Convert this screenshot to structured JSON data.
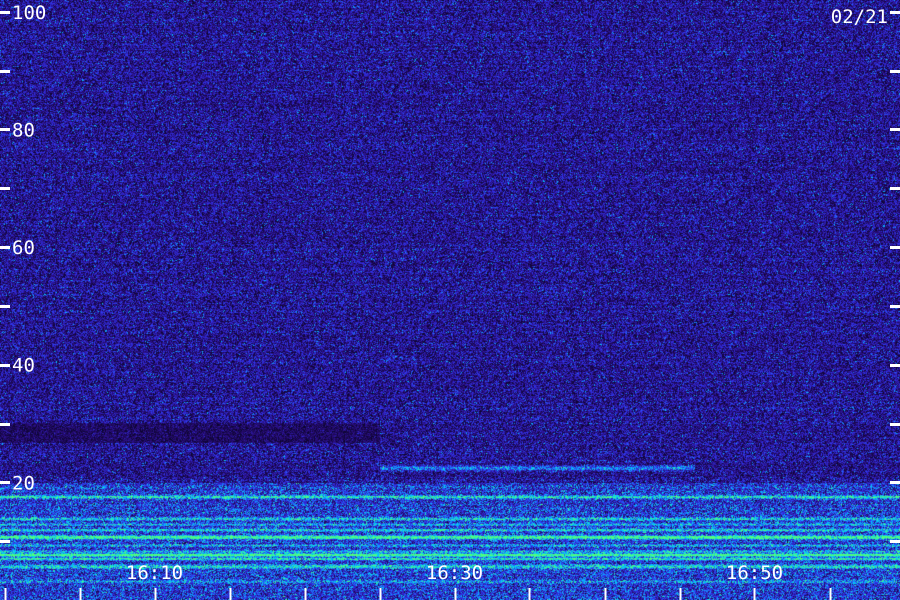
{
  "date_label": "02/21",
  "chart_data": {
    "type": "heatmap",
    "title": "",
    "xlabel": "",
    "ylabel": "",
    "x_tick_labels": [
      "16:10",
      "16:30",
      "16:50"
    ],
    "x_tick_minutes": [
      10,
      30,
      50
    ],
    "x_range_minutes": [
      -0.3,
      59.7
    ],
    "x_minor_every_minutes": 5,
    "y_tick_labels": [
      "20",
      "40",
      "60",
      "80",
      "100"
    ],
    "y_ticks": [
      20,
      40,
      60,
      80,
      100
    ],
    "y_minor_every": 10,
    "ylim": [
      0,
      102
    ],
    "grid": false,
    "colormap": [
      "#000000",
      "#2a0a7a",
      "#2a2aff",
      "#00c8ff",
      "#40ff80"
    ],
    "features": [
      {
        "kind": "band",
        "y": 22.5,
        "x_start": 25,
        "x_end": 46,
        "intensity": 0.55
      },
      {
        "kind": "noise-floor",
        "y_max": 20,
        "intensity": 0.45
      }
    ]
  }
}
